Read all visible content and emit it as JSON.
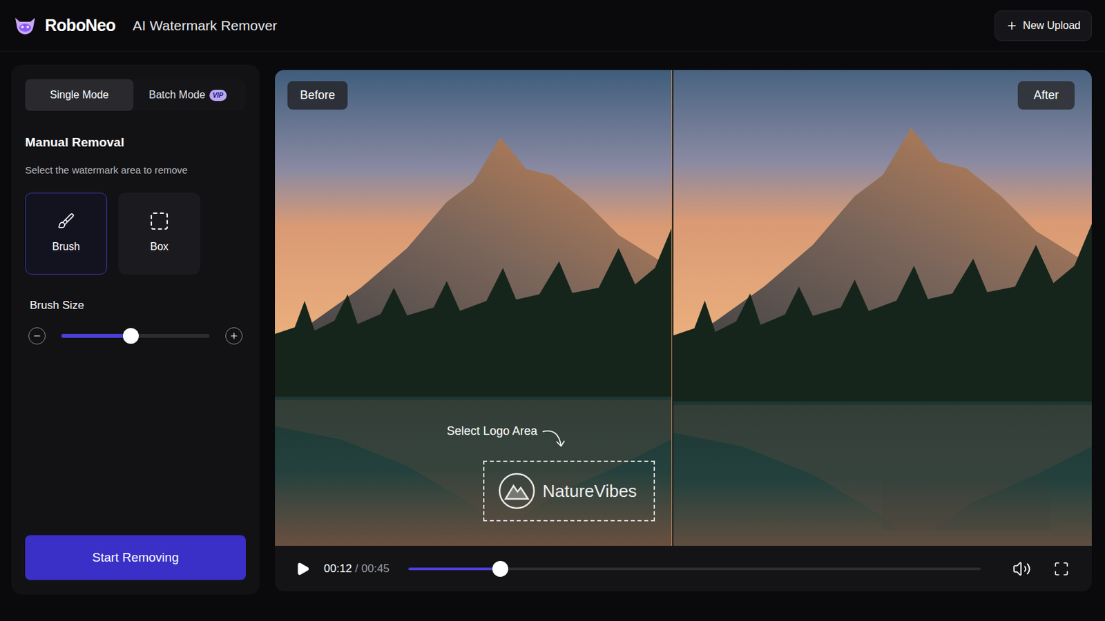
{
  "app": {
    "name": "RoboNeo",
    "title": "AI Watermark Remover"
  },
  "header_button": {
    "label": "New Upload"
  },
  "modes": [
    {
      "label": "Single Mode",
      "selected": true
    },
    {
      "label": "Batch Mode",
      "selected": false,
      "badge": "VIP"
    }
  ],
  "section": {
    "title": "Manual Removal",
    "hint": "Select the watermark area to remove"
  },
  "tools": [
    {
      "label": "Brush",
      "kind": "brush",
      "selected": true
    },
    {
      "label": "Box",
      "kind": "box",
      "selected": false
    }
  ],
  "brush_size": {
    "label": "Brush Size",
    "level": 0.47
  },
  "start_button": {
    "label": "Start Removing"
  },
  "preview": {
    "before_label": "Before",
    "after_label": "After",
    "annotation": "Select Logo Area",
    "watermark": "NatureVibes"
  },
  "player": {
    "current": "00:12",
    "separator": "/",
    "total": "00:45",
    "level": 0.16,
    "playing": false
  }
}
